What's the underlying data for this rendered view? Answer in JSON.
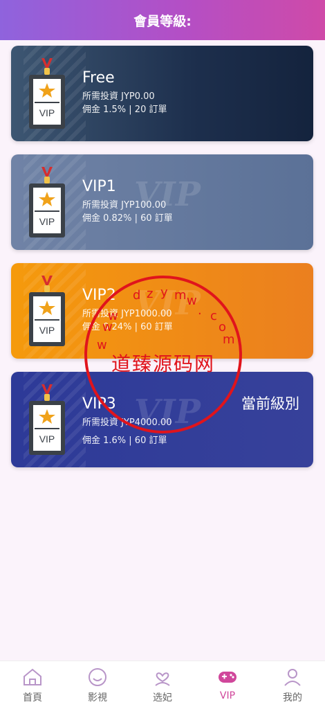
{
  "header": {
    "title": "會員等級:"
  },
  "levels": [
    {
      "name": "Free",
      "investment": "所需投資 JYP0.00",
      "commission": "佣金 1.5% | 20 訂單"
    },
    {
      "name": "VIP1",
      "investment": "所需投資 JYP100.00",
      "commission": "佣金 0.82% | 60 訂單"
    },
    {
      "name": "VIP2",
      "investment": "所需投資 JYP1000.00",
      "commission": "佣金 0.24% | 60 訂單"
    },
    {
      "name": "VIP3",
      "investment": "所需投資 JYP4000.00",
      "commission": "佣金 1.6% | 60 訂單",
      "current_label": "當前級別"
    }
  ],
  "badge_text": "VIP",
  "watermark_text": "VIP",
  "stamp": {
    "center_text": "道臻源码网",
    "ring_text": "www.dzym.com"
  },
  "tabbar": {
    "items": [
      {
        "label": "首頁",
        "icon": "home-icon"
      },
      {
        "label": "影視",
        "icon": "smile-icon"
      },
      {
        "label": "选妃",
        "icon": "heart-person-icon"
      },
      {
        "label": "VIP",
        "icon": "gamepad-icon",
        "active": true
      },
      {
        "label": "我的",
        "icon": "user-icon"
      }
    ]
  },
  "colors": {
    "header_start": "#8f63dd",
    "header_end": "#cf4aa8",
    "active_tab": "#d0479b",
    "stamp_red": "#e0141c",
    "vip2_orange": "#f59a0c",
    "vip3_blue": "#2d3a98"
  }
}
